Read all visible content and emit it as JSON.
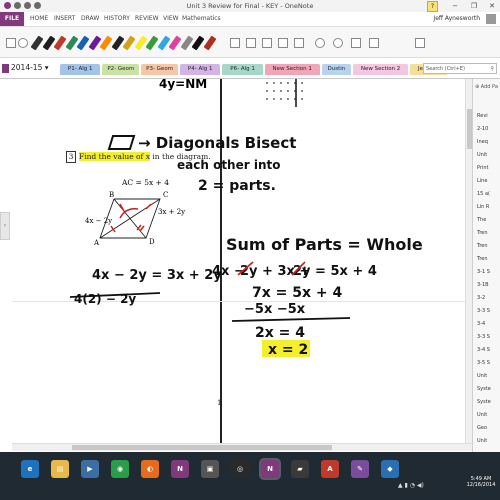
{
  "window": {
    "title": "Unit 3 Review for Final - KEY - OneNote"
  },
  "ribbon": {
    "file": "FILE",
    "tabs": [
      "HOME",
      "INSERT",
      "DRAW",
      "HISTORY",
      "REVIEW",
      "VIEW",
      "Mathematics"
    ],
    "user": "Jeff Aynesworth",
    "help": "?",
    "minimize": "−",
    "restore": "❐",
    "close": "✕"
  },
  "toolbar": {
    "pens": [
      "#333333",
      "#1f1f1f",
      "#c0392b",
      "#2e8b57",
      "#1a5fb4",
      "#6a1b9a",
      "#ff8c00",
      "#222222",
      "#d4a017",
      "#f4ee2d",
      "#3a9b3a",
      "#2ea8e0",
      "#e040a0",
      "#888888",
      "#111111",
      "#b03020"
    ]
  },
  "notebook": {
    "name": "2014-15",
    "sections": [
      {
        "label": "P1- Alg 1",
        "color": "#a4c3e8"
      },
      {
        "label": "P2- Geom",
        "color": "#c9e3a4"
      },
      {
        "label": "P3- Geom",
        "color": "#f6c6a6"
      },
      {
        "label": "P4- Alg 1",
        "color": "#d3b4e6"
      },
      {
        "label": "P6- Alg 1",
        "color": "#a6d8c9"
      },
      {
        "label": "New Section 1",
        "color": "#f3a5b8"
      },
      {
        "label": "Dustin",
        "color": "#b8d3ef"
      },
      {
        "label": "New Section 2",
        "color": "#f4c6e0"
      },
      {
        "label": "Jennifer",
        "color": "#f7de98"
      }
    ],
    "search_placeholder": "Search (Ctrl+E)"
  },
  "page": {
    "question_number": "3",
    "question_text_highlighted": "Find the value of x",
    "question_text_rest": " in the diagram.",
    "figure": {
      "equation": "AC = 5x + 4",
      "vertex_b": "B",
      "vertex_c": "C",
      "vertex_a": "A",
      "vertex_d": "D",
      "left_label": "4x − 2y",
      "right_label": "3x + 2y"
    },
    "page_number": "1",
    "ink": {
      "top_fragment": "4y=NM",
      "note_line1": "→ Diagonals Bisect",
      "note_line2": "each other into",
      "note_line3": "2 = parts.",
      "equation_left": "4x − 2y = 3x + 2y",
      "struck_out": "4(2) − 2y",
      "heading": "Sum of Parts = Whole",
      "sum_part1": "4x −",
      "sum_part2": "2y + 3x +",
      "sum_part3": "2y = 5x + 4",
      "line_a": "7x = 5x + 4",
      "line_b": "−5x  −5x",
      "line_c": "2x = 4",
      "answer": "x = 2"
    }
  },
  "pages_panel": {
    "add_page": "Add Pa",
    "items": [
      "Revi",
      "2-10",
      "Ineq",
      "Unit",
      "Print",
      "Line",
      "15 a(",
      "Lin R",
      "The",
      "Tren",
      "Tren",
      "Tren",
      "3-1 S",
      "3-1B",
      "3-2",
      "3-3 S",
      "3-4",
      "3-3 S",
      "3-4 S",
      "3-5 S",
      "Unit",
      "Syste",
      "Syste",
      "Unit",
      "Geo",
      "Unit"
    ]
  },
  "taskbar": {
    "apps": [
      {
        "label": "e",
        "color": "#1e73be"
      },
      {
        "label": "▤",
        "color": "#e8b84a"
      },
      {
        "label": "▶",
        "color": "#3a6ea5"
      },
      {
        "label": "◉",
        "color": "#2a9d4b"
      },
      {
        "label": "◐",
        "color": "#e86a1d"
      },
      {
        "label": "N",
        "color": "#80397b"
      },
      {
        "label": "▣",
        "color": "#555555"
      },
      {
        "label": "◎",
        "color": "#2a2a2a"
      },
      {
        "label": "N",
        "color": "#80397b"
      },
      {
        "label": "▰",
        "color": "#3a3a3a"
      },
      {
        "label": "A",
        "color": "#c0392b"
      },
      {
        "label": "✎",
        "color": "#7a4c9c"
      },
      {
        "label": "◆",
        "color": "#2b6fb3"
      }
    ],
    "time": "5:49 AM",
    "date": "12/16/2014"
  },
  "colors": {
    "accent": "#80397b",
    "highlight": "#f4ee2d",
    "ink": "#111111",
    "mark": "#d62020"
  }
}
